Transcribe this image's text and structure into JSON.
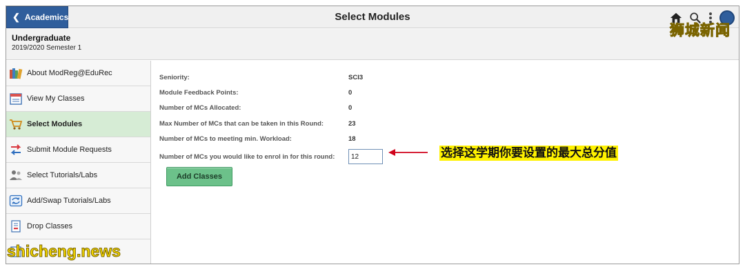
{
  "topbar": {
    "back_label": "Academics",
    "title": "Select Modules"
  },
  "header": {
    "career": "Undergraduate",
    "term": "2019/2020 Semester 1"
  },
  "sidebar": {
    "items": [
      {
        "label": "About ModReg@EduRec",
        "icon": "books-icon",
        "active": false
      },
      {
        "label": "View My Classes",
        "icon": "calendar-icon",
        "active": false
      },
      {
        "label": "Select Modules",
        "icon": "cart-icon",
        "active": true
      },
      {
        "label": "Submit Module Requests",
        "icon": "swap-arrows-icon",
        "active": false
      },
      {
        "label": "Select Tutorials/Labs",
        "icon": "people-icon",
        "active": false
      },
      {
        "label": "Add/Swap Tutorials/Labs",
        "icon": "refresh-icon",
        "active": false
      },
      {
        "label": "Drop Classes",
        "icon": "document-minus-icon",
        "active": false
      },
      {
        "label": "",
        "icon": "checklist-icon",
        "active": false
      }
    ]
  },
  "main": {
    "fields": [
      {
        "label": "Seniority:",
        "value": "SCI3"
      },
      {
        "label": "Module Feedback Points:",
        "value": "0"
      },
      {
        "label": "Number of MCs Allocated:",
        "value": "0"
      },
      {
        "label": "Max Number of MCs that can be taken in this Round:",
        "value": "23"
      },
      {
        "label": "Number of MCs to meeting min. Workload:",
        "value": "18"
      }
    ],
    "enrol_label": "Number of MCs you would like to enrol in for this round:",
    "enrol_value": "12",
    "add_button": "Add Classes"
  },
  "annotation": {
    "text": "选择这学期你要设置的最大总分值",
    "color": "#fff200",
    "arrow_color": "#d0021b"
  },
  "watermarks": {
    "top": "狮城新闻",
    "bottom": "shicheng.news"
  },
  "colors": {
    "back_button": "#2f5e9c",
    "active_nav": "#d6ecd5",
    "add_button": "#6cc18a"
  }
}
